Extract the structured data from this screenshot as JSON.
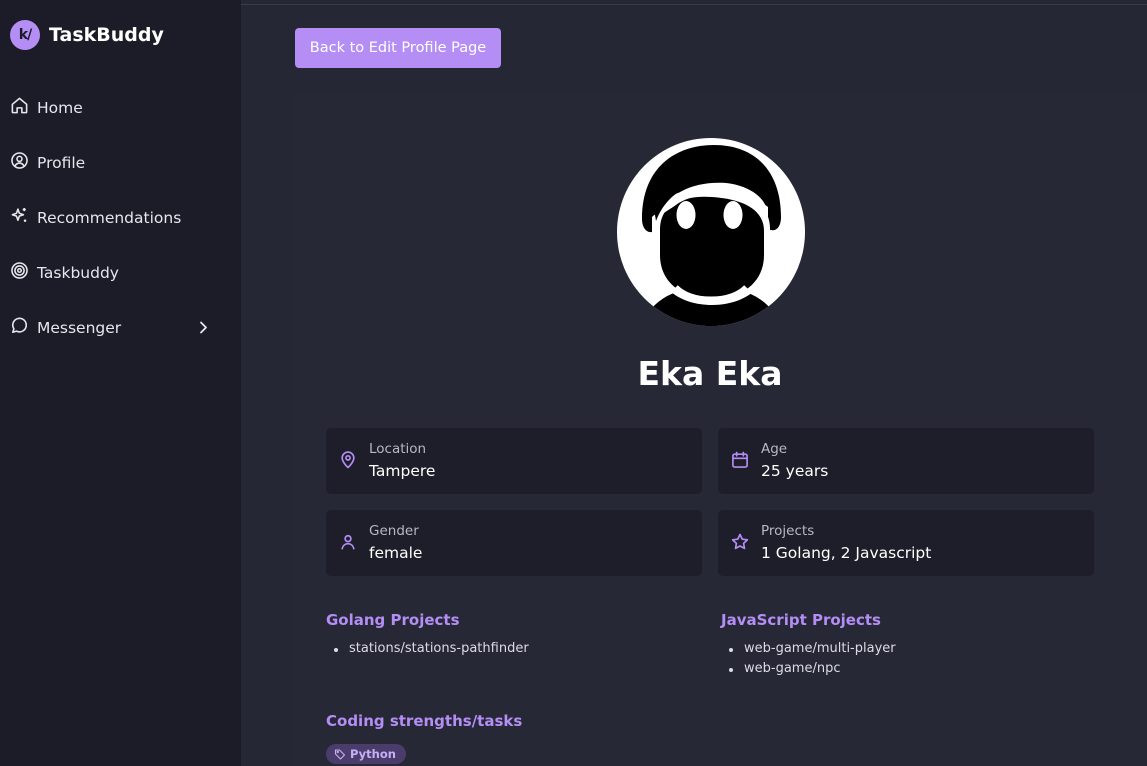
{
  "brand": {
    "logo_text": "k/",
    "name": "TaskBuddy"
  },
  "sidebar": {
    "items": [
      {
        "label": "Home",
        "icon": "home-icon"
      },
      {
        "label": "Profile",
        "icon": "user-circle-icon"
      },
      {
        "label": "Recommendations",
        "icon": "sparkles-icon"
      },
      {
        "label": "Taskbuddy",
        "icon": "target-icon"
      },
      {
        "label": "Messenger",
        "icon": "message-circle-icon"
      }
    ]
  },
  "header": {
    "back_label": "Back to Edit Profile Page"
  },
  "profile": {
    "name": "Eka Eka",
    "cards": {
      "location": {
        "label": "Location",
        "value": "Tampere"
      },
      "age": {
        "label": "Age",
        "value": "25 years"
      },
      "gender": {
        "label": "Gender",
        "value": "female"
      },
      "projects": {
        "label": "Projects",
        "value": "1 Golang, 2 Javascript"
      }
    },
    "golang": {
      "title": "Golang Projects",
      "items": [
        "stations/stations-pathfinder"
      ]
    },
    "javascript": {
      "title": "JavaScript Projects",
      "items": [
        "web-game/multi-player",
        "web-game/npc"
      ]
    },
    "strengths": {
      "title": "Coding strengths/tasks",
      "tags": [
        "Python"
      ]
    }
  },
  "colors": {
    "accent": "#b48ef5",
    "sidebar_bg": "#1b1c27",
    "main_bg": "#262734",
    "card_bg": "#1d1e29"
  }
}
